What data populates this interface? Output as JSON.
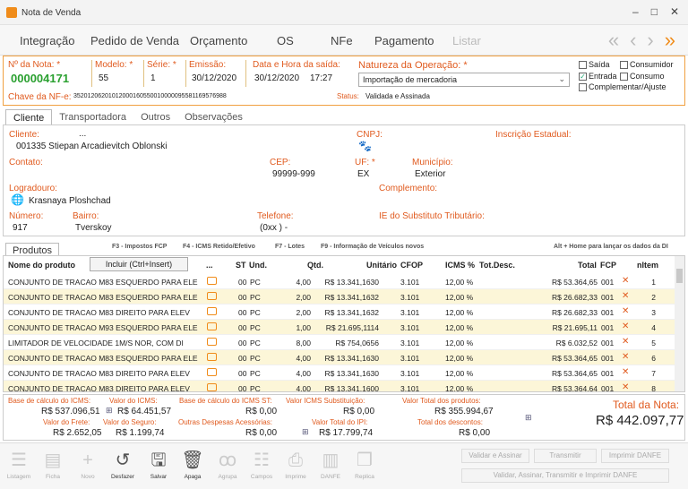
{
  "window": {
    "title": "Nota de Venda",
    "min": "–",
    "max": "□",
    "close": "✕"
  },
  "menu": {
    "items": [
      "Integração",
      "Pedido de Venda",
      "Orçamento",
      "OS",
      "NFe",
      "Pagamento",
      "Listar"
    ]
  },
  "nav": {
    "first": "«",
    "prev": "‹",
    "next": "›",
    "last": "»"
  },
  "header": {
    "nota_label": "Nº da Nota: *",
    "nota_value": "000004171",
    "modelo_label": "Modelo: *",
    "modelo_value": "55",
    "serie_label": "Série: *",
    "serie_value": "1",
    "emissao_label": "Emissão:",
    "emissao_value": "30/12/2020",
    "saida_label": "Data e Hora da saída:",
    "saida_date": "30/12/2020",
    "saida_time": "17:27",
    "natureza_label": "Natureza da Operação: *",
    "natureza_value": "Importação de mercadoria",
    "chave_label": "Chave da NF-e:",
    "chave_value": "35201206201012000160550010000095581169576988",
    "status_label": "Status:",
    "status_value": "Validada e Assinada",
    "checks": {
      "saida": "Saída",
      "consumidor": "Consumidor",
      "entrada": "Entrada",
      "consumo": "Consumo",
      "complementar": "Complementar/Ajuste"
    }
  },
  "tabs": [
    "Cliente",
    "Transportadora",
    "Outros",
    "Observações"
  ],
  "cliente": {
    "cliente_label": "Cliente:",
    "cliente_dots": "...",
    "cliente_value": "001335 Stiepan Arcadievitch Oblonski",
    "cnpj_label": "CNPJ:",
    "ie_label": "Inscrição Estadual:",
    "contato_label": "Contato:",
    "cep_label": "CEP:",
    "cep_value": "99999-999",
    "uf_label": "UF: *",
    "uf_value": "EX",
    "municipio_label": "Município:",
    "municipio_value": "Exterior",
    "logradouro_label": "Logradouro:",
    "logradouro_value": "Krasnaya Ploshchad",
    "complemento_label": "Complemento:",
    "numero_label": "Número:",
    "numero_value": "917",
    "bairro_label": "Bairro:",
    "bairro_value": "Tverskoy",
    "telefone_label": "Telefone:",
    "telefone_value": "(0xx )  -",
    "ie_sub_label": "IE do Substituto Tributário:"
  },
  "produtos": {
    "tab_label": "Produtos",
    "hints": [
      "F3 - Impostos FCP",
      "F4 - ICMS Retido/Efetivo",
      "F7 - Lotes",
      "F9 - Informação de Veículos novos"
    ],
    "hint_right": "Alt + Home para lançar os dados da DI",
    "include_button": "Incluir (Ctrl+Insert)",
    "columns": {
      "nome": "Nome do produto",
      "dots": "...",
      "st": "ST",
      "und": "Und.",
      "qtd": "Qtd.",
      "unit": "Unitário",
      "cfop": "CFOP",
      "icms": "ICMS %",
      "desc": "Tot.Desc.",
      "total": "Total",
      "fcp": "FCP",
      "item": "nItem"
    },
    "rows": [
      {
        "nome": "CONJUNTO DE TRACAO M83 ESQUERDO PARA ELE",
        "st": "00",
        "und": "PC",
        "qtd": "4,00",
        "unit": "R$ 13.341,1630",
        "cfop": "3.101",
        "icms": "12,00 %",
        "total": "R$ 53.364,65",
        "fcp": "001",
        "item": "1"
      },
      {
        "nome": "CONJUNTO DE TRACAO M83 ESQUERDO PARA ELE",
        "st": "00",
        "und": "PC",
        "qtd": "2,00",
        "unit": "R$ 13.341,1632",
        "cfop": "3.101",
        "icms": "12,00 %",
        "total": "R$ 26.682,33",
        "fcp": "001",
        "item": "2"
      },
      {
        "nome": "CONJUNTO DE TRACAO M83 DIREITO PARA ELEV",
        "st": "00",
        "und": "PC",
        "qtd": "2,00",
        "unit": "R$ 13.341,1632",
        "cfop": "3.101",
        "icms": "12,00 %",
        "total": "R$ 26.682,33",
        "fcp": "001",
        "item": "3"
      },
      {
        "nome": "CONJUNTO DE TRACAO M93 ESQUERDO PARA ELE",
        "st": "00",
        "und": "PC",
        "qtd": "1,00",
        "unit": "R$ 21.695,1114",
        "cfop": "3.101",
        "icms": "12,00 %",
        "total": "R$ 21.695,11",
        "fcp": "001",
        "item": "4"
      },
      {
        "nome": "LIMITADOR DE VELOCIDADE 1M/S NOR, COM DI",
        "st": "00",
        "und": "PC",
        "qtd": "8,00",
        "unit": "R$ 754,0656",
        "cfop": "3.101",
        "icms": "12,00 %",
        "total": "R$ 6.032,52",
        "fcp": "001",
        "item": "5"
      },
      {
        "nome": "CONJUNTO DE TRACAO M83 ESQUERDO PARA ELE",
        "st": "00",
        "und": "PC",
        "qtd": "4,00",
        "unit": "R$ 13.341,1630",
        "cfop": "3.101",
        "icms": "12,00 %",
        "total": "R$ 53.364,65",
        "fcp": "001",
        "item": "6"
      },
      {
        "nome": "CONJUNTO DE TRACAO M83 DIREITO PARA ELEV",
        "st": "00",
        "und": "PC",
        "qtd": "4,00",
        "unit": "R$ 13.341,1630",
        "cfop": "3.101",
        "icms": "12,00 %",
        "total": "R$ 53.364,65",
        "fcp": "001",
        "item": "7"
      },
      {
        "nome": "CONJUNTO DE TRACAO M83 DIREITO PARA ELEV",
        "st": "00",
        "und": "PC",
        "qtd": "4,00",
        "unit": "R$ 13.341,1600",
        "cfop": "3.101",
        "icms": "12,00 %",
        "total": "R$ 53.364,64",
        "fcp": "001",
        "item": "8"
      }
    ]
  },
  "totals": {
    "bc_icms_label": "Base de cálculo do ICMS:",
    "bc_icms": "R$ 537.096,51",
    "icms_label": "Valor do ICMS:",
    "icms": "R$ 64.451,57",
    "bc_st_label": "Base de cálculo do ICMS ST:",
    "bc_st": "R$ 0,00",
    "st_label": "Valor ICMS Substituição:",
    "st": "R$ 0,00",
    "produtos_label": "Valor Total dos produtos:",
    "produtos": "R$ 355.994,67",
    "frete_label": "Valor do Frete:",
    "frete": "R$ 2.652,05",
    "seguro_label": "Valor do Seguro:",
    "seguro": "R$ 1.199,74",
    "outras_label": "Outras Despesas Acessórias:",
    "outras": "R$ 0,00",
    "ipi_label": "Valor Total do IPI:",
    "ipi": "R$ 17.799,74",
    "descontos_label": "Total dos descontos:",
    "descontos": "R$ 0,00",
    "nota_label": "Total da Nota:",
    "nota": "R$ 442.097,77"
  },
  "toolbar": {
    "items": [
      "Listagem",
      "Ficha",
      "Novo",
      "Desfazer",
      "Salvar",
      "Apaga",
      "Agrupa",
      "Campos",
      "Imprime",
      "DANFE",
      "Replica"
    ],
    "validar": "Validar e Assinar",
    "transmitir": "Transmitir",
    "imprimir": "Imprimir DANFE",
    "todos": "Validar, Assinar, Transmitir e Imprimir DANFE"
  }
}
